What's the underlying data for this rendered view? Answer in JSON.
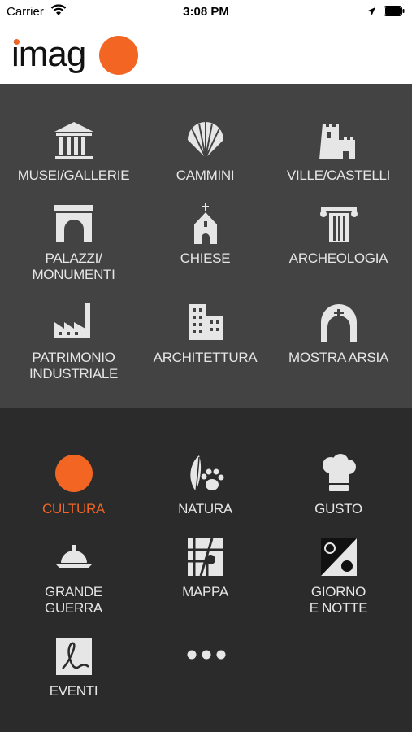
{
  "status_bar": {
    "carrier": "Carrier",
    "time": "3:08 PM"
  },
  "header": {
    "logo_text": "imag"
  },
  "categories": [
    {
      "label": "MUSEI/GALLERIE",
      "icon": "museum-icon"
    },
    {
      "label": "CAMMINI",
      "icon": "shell-icon"
    },
    {
      "label": "VILLE/CASTELLI",
      "icon": "castle-icon"
    },
    {
      "label": "PALAZZI/\nMONUMENTI",
      "icon": "arch-icon"
    },
    {
      "label": "CHIESE",
      "icon": "church-icon"
    },
    {
      "label": "ARCHEOLOGIA",
      "icon": "column-icon"
    },
    {
      "label": "PATRIMONIO\nINDUSTRIALE",
      "icon": "factory-icon"
    },
    {
      "label": "ARCHITETTURA",
      "icon": "building-icon"
    },
    {
      "label": "MOSTRA ARSIA",
      "icon": "mine-icon"
    }
  ],
  "sections": [
    {
      "label": "CULTURA",
      "icon": "culture-circle-icon",
      "active": true
    },
    {
      "label": "NATURA",
      "icon": "nature-icon",
      "active": false
    },
    {
      "label": "GUSTO",
      "icon": "chef-hat-icon",
      "active": false
    },
    {
      "label": "GRANDE\nGUERRA",
      "icon": "helmet-icon",
      "active": false
    },
    {
      "label": "MAPPA",
      "icon": "map-icon",
      "active": false
    },
    {
      "label": "GIORNO\nE NOTTE",
      "icon": "day-night-icon",
      "active": false
    },
    {
      "label": "EVENTI",
      "icon": "events-icon",
      "active": false
    }
  ],
  "colors": {
    "accent": "#f26522",
    "panel_top": "#434343",
    "panel_bottom": "#2b2b2b",
    "icon": "#e6e6e6"
  },
  "more": {
    "icon": "more-dots-icon"
  }
}
